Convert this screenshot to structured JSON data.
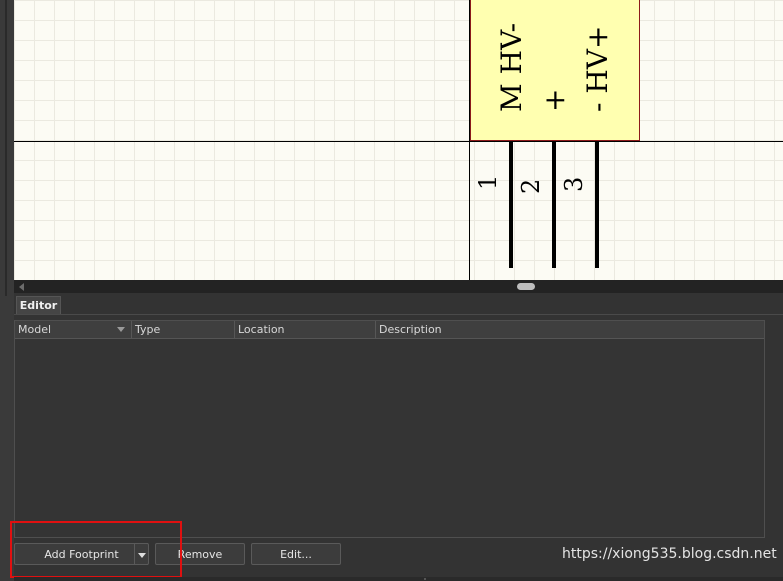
{
  "schematic": {
    "pin_names": [
      "M HV-",
      "+",
      "- HV+"
    ],
    "pin_numbers": [
      "1",
      "2",
      "3"
    ],
    "colors": {
      "canvas": "#fcfbf4",
      "component_fill": "#ffffb0",
      "component_border": "#8b1a1a",
      "pin": "#000000"
    }
  },
  "editor": {
    "tab_label": "Editor",
    "columns": [
      "Model",
      "Type",
      "Location",
      "Description"
    ],
    "rows": []
  },
  "buttons": {
    "add_footprint": "Add Footprint",
    "remove": "Remove",
    "edit": "Edit..."
  },
  "icons": {
    "dropdown": "chevron-down-icon",
    "scroll_left": "arrow-left-icon",
    "sort": "sort-down-icon"
  },
  "highlight_color": "#e01010",
  "watermark": "https://xiong535.blog.csdn.net"
}
